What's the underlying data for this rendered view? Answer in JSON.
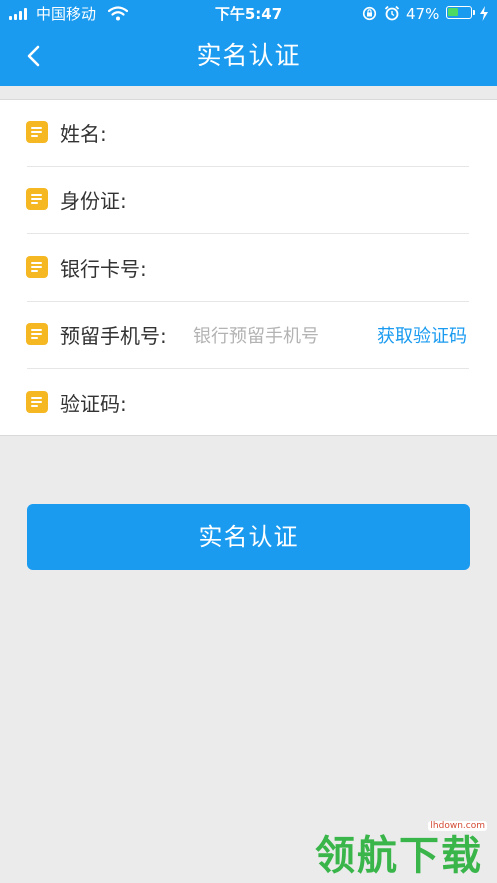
{
  "status_bar": {
    "carrier": "中国移动",
    "time": "下午5:47",
    "battery_percent": "47%",
    "battery_level": 0.47,
    "icons": [
      "signal-icon",
      "wifi-icon",
      "rotation-lock-icon",
      "alarm-icon",
      "battery-icon",
      "charging-icon"
    ]
  },
  "nav": {
    "title": "实名认证",
    "back_icon": "chevron-left-icon"
  },
  "form": {
    "fields": [
      {
        "label": "姓名:",
        "value": "",
        "placeholder": ""
      },
      {
        "label": "身份证:",
        "value": "",
        "placeholder": ""
      },
      {
        "label": "银行卡号:",
        "value": "",
        "placeholder": ""
      },
      {
        "label": "预留手机号:",
        "value": "",
        "placeholder": "银行预留手机号"
      },
      {
        "label": "验证码:",
        "value": "",
        "placeholder": ""
      }
    ],
    "get_code_label": "获取验证码",
    "field_icon": "note-icon"
  },
  "submit_label": "实名认证",
  "watermark": {
    "text": "领航下载",
    "url": "lhdown.com"
  },
  "colors": {
    "primary": "#1a9bf0",
    "icon_yellow": "#f5b823",
    "background": "#ebebeb"
  }
}
